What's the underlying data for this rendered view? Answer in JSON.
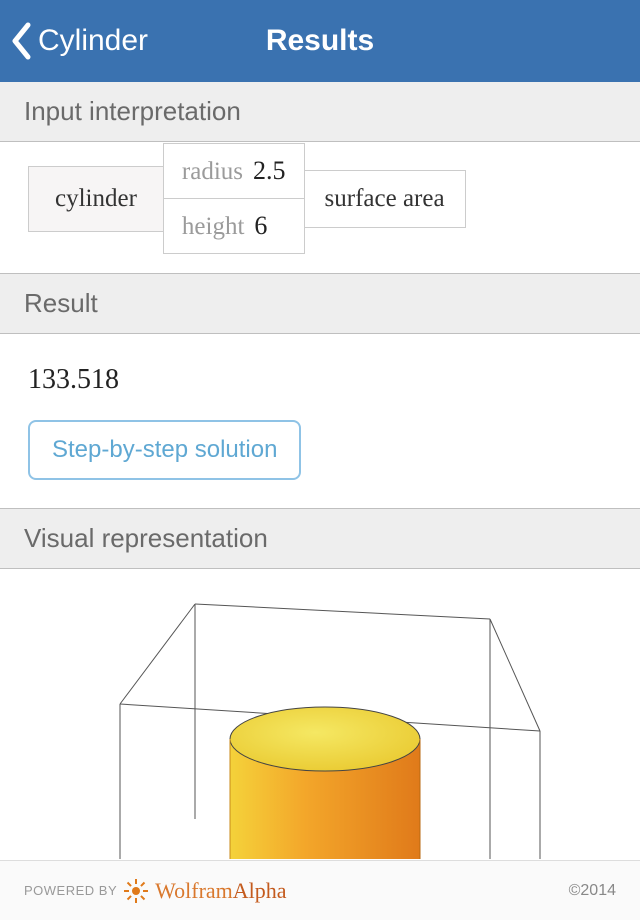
{
  "header": {
    "back_label": "Cylinder",
    "title": "Results"
  },
  "sections": {
    "interpretation_header": "Input interpretation",
    "result_header": "Result",
    "visual_header": "Visual representation"
  },
  "interpretation": {
    "shape": "cylinder",
    "params": [
      {
        "label": "radius",
        "value": "2.5"
      },
      {
        "label": "height",
        "value": "6"
      }
    ],
    "quantity": "surface area"
  },
  "result": {
    "value": "133.518"
  },
  "actions": {
    "step_by_step": "Step-by-step solution"
  },
  "footer": {
    "powered": "POWERED BY",
    "brand_left": "Wolfram",
    "brand_right": "Alpha",
    "copyright": "©2014"
  }
}
